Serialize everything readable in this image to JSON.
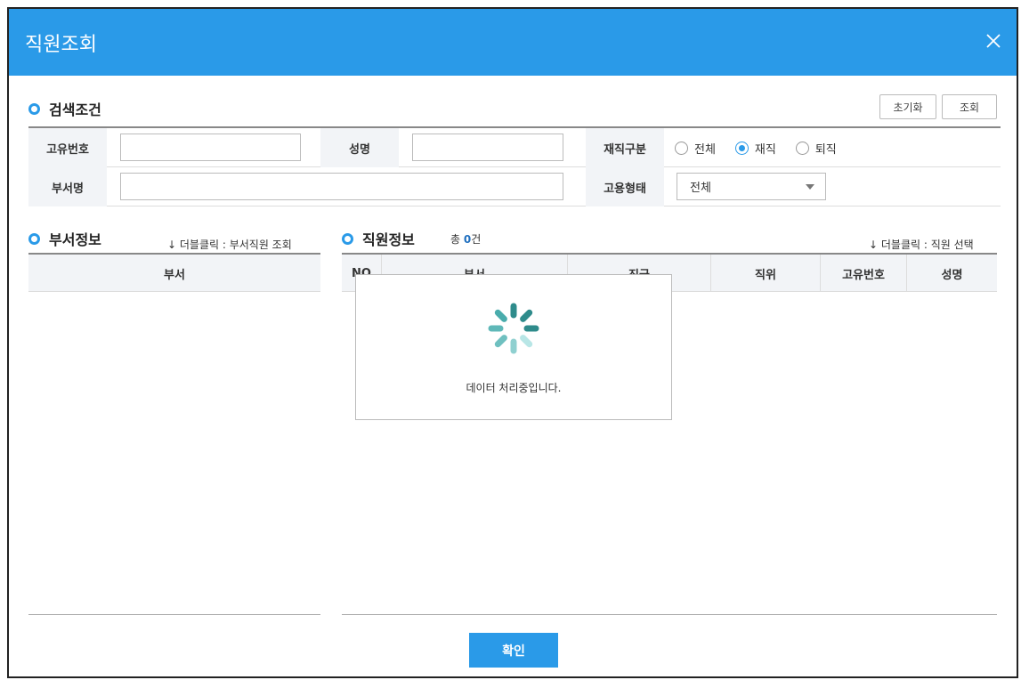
{
  "dialog": {
    "title": "직원조회"
  },
  "search": {
    "heading": "검색조건",
    "reset_label": "초기화",
    "search_label": "조회",
    "id_label": "고유번호",
    "id_value": "",
    "name_label": "성명",
    "name_value": "",
    "status_label": "재직구분",
    "status_options": [
      "전체",
      "재직",
      "퇴직"
    ],
    "status_selected": "재직",
    "dept_label": "부서명",
    "dept_value": "",
    "emp_type_label": "고용형태",
    "emp_type_value": "전체"
  },
  "dept_panel": {
    "heading": "부서정보",
    "hint": "↓ 더블클릭 : 부서직원 조회",
    "columns": [
      "부서"
    ]
  },
  "emp_panel": {
    "heading": "직원정보",
    "count_prefix": "총 ",
    "count_value": "0",
    "count_suffix": "건",
    "hint": "↓ 더블클릭 : 직원 선택",
    "columns": [
      "NO",
      "부서",
      "직급",
      "직위",
      "고유번호",
      "성명"
    ]
  },
  "loading": {
    "message": "데이터 처리중입니다."
  },
  "footer": {
    "confirm_label": "확인"
  },
  "colors": {
    "accent": "#2a9ae8",
    "spinner_dark": "#2e8b8b",
    "spinner_light": "#b8e6e6"
  }
}
